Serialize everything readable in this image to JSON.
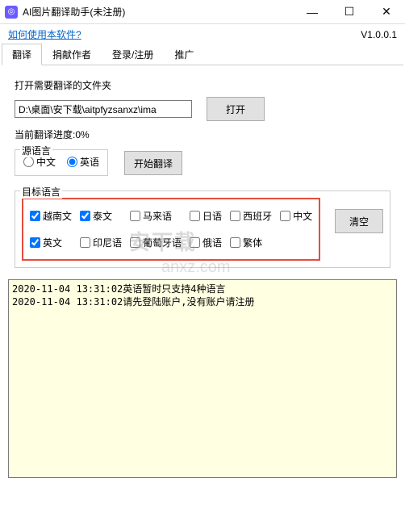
{
  "window": {
    "title": "AI图片翻译助手(未注册)",
    "icon_glyph": "◎"
  },
  "help_link": "如何使用本软件?",
  "version": "V1.0.0.1",
  "tabs": [
    "翻译",
    "捐献作者",
    "登录/注册",
    "推广"
  ],
  "folder": {
    "label": "打开需要翻译的文件夹",
    "path": "D:\\桌面\\安下载\\aitpfyzsanxz\\ima",
    "open_btn": "打开"
  },
  "progress": {
    "label": "当前翻译进度:",
    "value": "0%"
  },
  "source": {
    "legend": "源语言",
    "options": [
      "中文",
      "英语"
    ],
    "selected": "英语"
  },
  "start_btn": "开始翻译",
  "target": {
    "legend": "目标语言",
    "options": [
      {
        "label": "越南文",
        "checked": true
      },
      {
        "label": "泰文",
        "checked": true
      },
      {
        "label": "马来语",
        "checked": false
      },
      {
        "label": "日语",
        "checked": false
      },
      {
        "label": "西班牙",
        "checked": false
      },
      {
        "label": "中文",
        "checked": false
      },
      {
        "label": "英文",
        "checked": true
      },
      {
        "label": "印尼语",
        "checked": false
      },
      {
        "label": "葡萄牙语",
        "checked": false
      },
      {
        "label": "俄语",
        "checked": false
      },
      {
        "label": "繁体",
        "checked": false
      }
    ],
    "clear_btn": "清空"
  },
  "log_lines": [
    "2020-11-04 13:31:02英语暂时只支持4种语言",
    "2020-11-04 13:31:02请先登陆账户,没有账户请注册"
  ],
  "watermark1": "安下载",
  "watermark2": "anxz.com"
}
